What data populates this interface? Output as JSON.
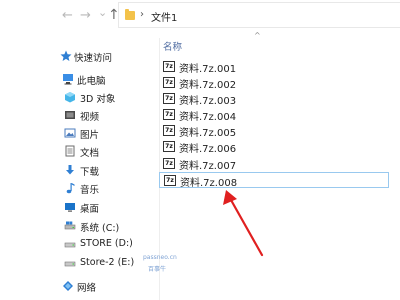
{
  "nav": {
    "back_glyph": "←",
    "forward_glyph": "→",
    "recent_glyph": "⌄",
    "up_glyph": "↑",
    "breadcrumb_sep": "›",
    "address": "文件1"
  },
  "sidebar": {
    "items": [
      {
        "label": "快速访问",
        "icon": "star-icon"
      },
      {
        "label": "此电脑",
        "icon": "computer-icon"
      },
      {
        "label": "3D 对象",
        "icon": "3d-objects-icon"
      },
      {
        "label": "视频",
        "icon": "video-icon"
      },
      {
        "label": "图片",
        "icon": "pictures-icon"
      },
      {
        "label": "文档",
        "icon": "documents-icon"
      },
      {
        "label": "下载",
        "icon": "download-icon"
      },
      {
        "label": "音乐",
        "icon": "music-icon"
      },
      {
        "label": "桌面",
        "icon": "desktop-icon"
      },
      {
        "label": "系统 (C:)",
        "icon": "system-drive-icon"
      },
      {
        "label": "STORE (D:)",
        "icon": "drive-icon"
      },
      {
        "label": "Store-2 (E:)",
        "icon": "drive-icon"
      },
      {
        "label": "网络",
        "icon": "network-icon"
      }
    ]
  },
  "file_list": {
    "column_name": "名称",
    "sort_glyph": "^",
    "icon_text": "7z",
    "files": [
      "资料.7z.001",
      "资料.7z.002",
      "资料.7z.003",
      "资料.7z.004",
      "资料.7z.005",
      "资料.7z.006",
      "资料.7z.007",
      "资料.7z.008"
    ],
    "selected_index": 7
  },
  "watermark": {
    "line1": "passneo.cn",
    "line2": "百事牛"
  },
  "colors": {
    "accent": "#0078d7",
    "folder": "#f3c24a",
    "arrow": "#e02020",
    "selection_border": "#99c9ef"
  }
}
